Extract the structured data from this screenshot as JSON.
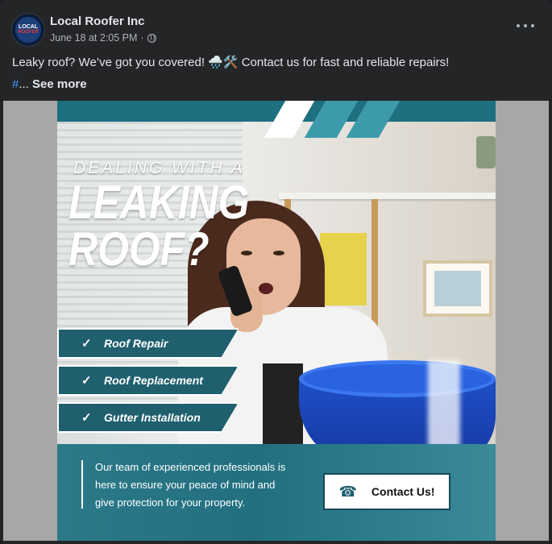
{
  "post": {
    "page_name": "Local Roofer Inc",
    "avatar_line1": "LOCAL",
    "avatar_line2": "ROOFER",
    "date": "June 18 at 2:05 PM",
    "separator": "·",
    "text": "Leaky roof? We’ve got you covered! 🌧️🛠️ Contact us for fast and reliable repairs!",
    "hash": "#",
    "ellipsis": "...",
    "see_more": "See more"
  },
  "ad": {
    "headline_small": "DEALING WITH A",
    "headline_big_1": "LEAKING",
    "headline_big_2": "ROOF?",
    "services": [
      "Roof Repair",
      "Roof Replacement",
      "Gutter Installation"
    ],
    "check_symbol": "✓",
    "tagline": "Our team of experienced professionals is here to ensure your peace of mind and give protection for your property.",
    "contact_label": "Contact Us!",
    "phone_symbol": "☎"
  },
  "icons": {
    "globe": "globe-icon",
    "more": "more-options-icon",
    "phone": "phone-icon",
    "check": "checkmark-icon"
  },
  "colors": {
    "card_bg": "#242526",
    "text_primary": "#e4e6eb",
    "text_secondary": "#b0b3b8",
    "link": "#4599ff",
    "teal": "#1f5f6e",
    "bucket_blue": "#1f4fc7"
  }
}
